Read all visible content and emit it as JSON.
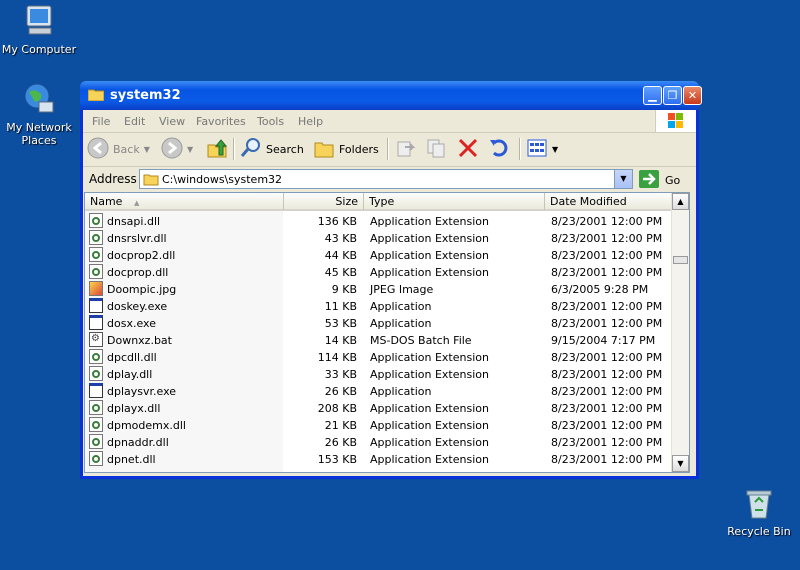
{
  "desktop": {
    "my_computer": "My Computer",
    "my_network": "My Network Places",
    "recycle_bin": "Recycle Bin"
  },
  "window": {
    "title": "system32",
    "menu": [
      "File",
      "Edit",
      "View",
      "Favorites",
      "Tools",
      "Help"
    ],
    "toolbar": {
      "back": "Back",
      "search": "Search",
      "folders": "Folders"
    },
    "address": {
      "label": "Address",
      "value": "C:\\windows\\system32",
      "go": "Go"
    }
  },
  "columns": [
    "Name",
    "Size",
    "Type",
    "Date Modified"
  ],
  "files": [
    {
      "name": "dnsapi.dll",
      "size": "136 KB",
      "type": "Application Extension",
      "date": "8/23/2001 12:00 PM",
      "icon": "dll"
    },
    {
      "name": "dnsrslvr.dll",
      "size": "43 KB",
      "type": "Application Extension",
      "date": "8/23/2001 12:00 PM",
      "icon": "dll"
    },
    {
      "name": "docprop2.dll",
      "size": "44 KB",
      "type": "Application Extension",
      "date": "8/23/2001 12:00 PM",
      "icon": "dll"
    },
    {
      "name": "docprop.dll",
      "size": "45 KB",
      "type": "Application Extension",
      "date": "8/23/2001 12:00 PM",
      "icon": "dll"
    },
    {
      "name": "Doompic.jpg",
      "size": "9 KB",
      "type": "JPEG Image",
      "date": "6/3/2005 9:28 PM",
      "icon": "jpg"
    },
    {
      "name": "doskey.exe",
      "size": "11 KB",
      "type": "Application",
      "date": "8/23/2001 12:00 PM",
      "icon": "exe"
    },
    {
      "name": "dosx.exe",
      "size": "53 KB",
      "type": "Application",
      "date": "8/23/2001 12:00 PM",
      "icon": "exe"
    },
    {
      "name": "Downxz.bat",
      "size": "14 KB",
      "type": "MS-DOS Batch File",
      "date": "9/15/2004 7:17 PM",
      "icon": "bat"
    },
    {
      "name": "dpcdll.dll",
      "size": "114 KB",
      "type": "Application Extension",
      "date": "8/23/2001 12:00 PM",
      "icon": "dll"
    },
    {
      "name": "dplay.dll",
      "size": "33 KB",
      "type": "Application Extension",
      "date": "8/23/2001 12:00 PM",
      "icon": "dll"
    },
    {
      "name": "dplaysvr.exe",
      "size": "26 KB",
      "type": "Application",
      "date": "8/23/2001 12:00 PM",
      "icon": "exe"
    },
    {
      "name": "dplayx.dll",
      "size": "208 KB",
      "type": "Application Extension",
      "date": "8/23/2001 12:00 PM",
      "icon": "dll"
    },
    {
      "name": "dpmodemx.dll",
      "size": "21 KB",
      "type": "Application Extension",
      "date": "8/23/2001 12:00 PM",
      "icon": "dll"
    },
    {
      "name": "dpnaddr.dll",
      "size": "26 KB",
      "type": "Application Extension",
      "date": "8/23/2001 12:00 PM",
      "icon": "dll"
    },
    {
      "name": "dpnet.dll",
      "size": "153 KB",
      "type": "Application Extension",
      "date": "8/23/2001 12:00 PM",
      "icon": "dll"
    }
  ]
}
